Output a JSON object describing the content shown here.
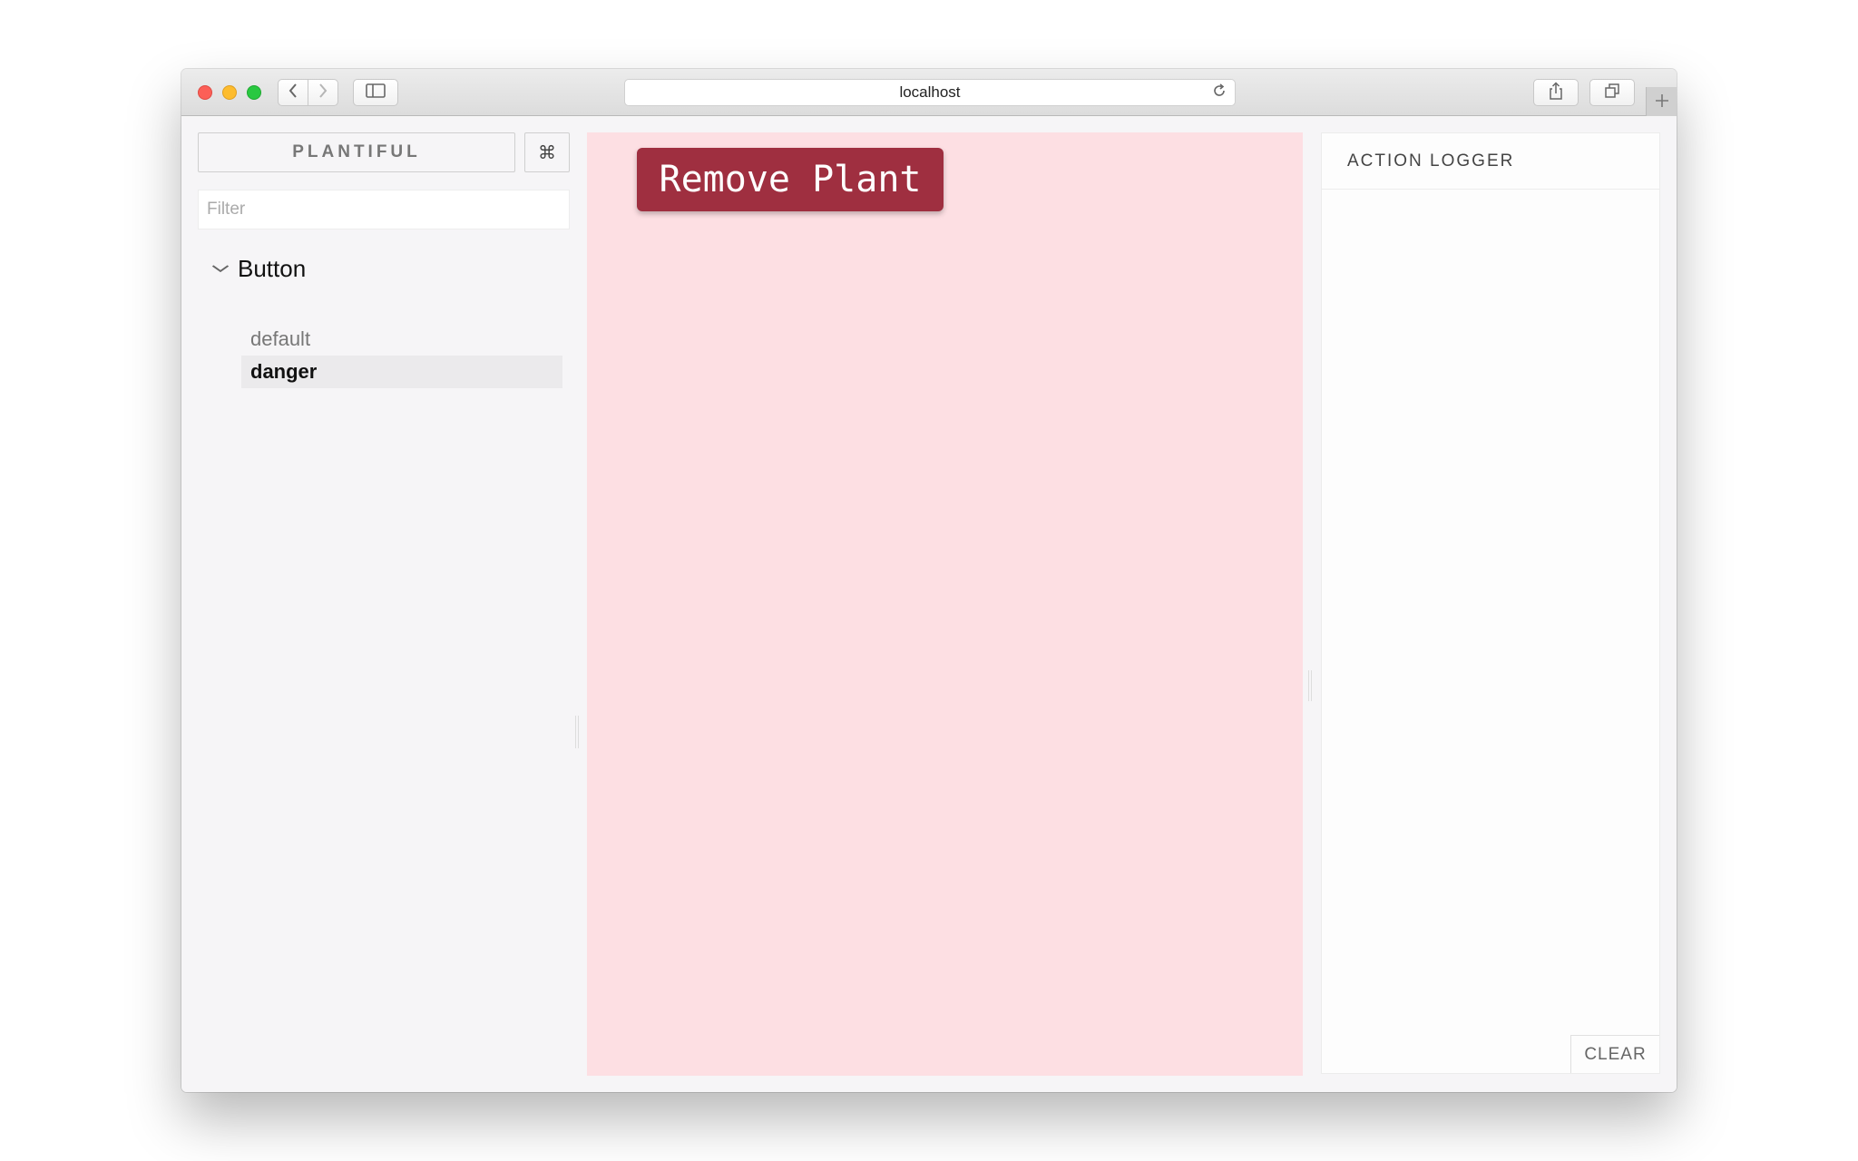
{
  "browser": {
    "url": "localhost",
    "icons": {
      "back": "chevron-left-icon",
      "forward": "chevron-right-icon",
      "sidebar": "sidebar-icon",
      "reload": "reload-icon",
      "share": "share-icon",
      "tabs": "tabs-icon",
      "new_tab": "plus-icon"
    }
  },
  "sidebar": {
    "brand_label": "PLANTIFUL",
    "shortcuts_glyph": "⌘",
    "filter_placeholder": "Filter",
    "kind": {
      "label": "Button",
      "expanded": true,
      "stories": [
        {
          "label": "default",
          "selected": false
        },
        {
          "label": "danger",
          "selected": true
        }
      ]
    }
  },
  "preview": {
    "button_label": "Remove Plant",
    "background_color": "#fddfe3",
    "button_color": "#9f2f40"
  },
  "action_logger": {
    "title": "ACTION LOGGER",
    "clear_label": "CLEAR"
  }
}
